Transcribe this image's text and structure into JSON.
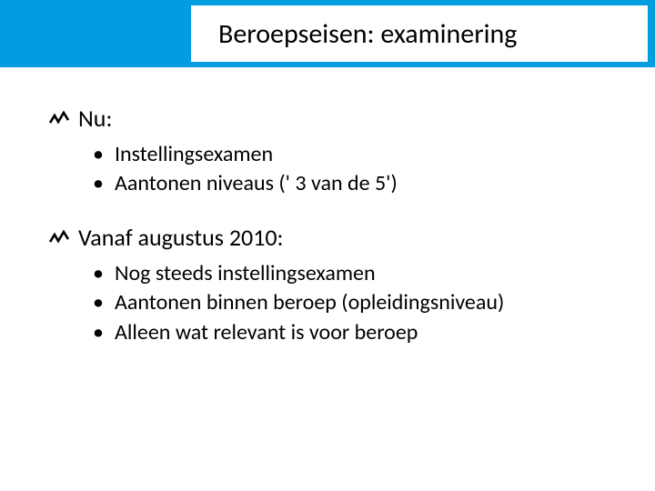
{
  "header": {
    "title": "Beroepseisen: examinering"
  },
  "sections": [
    {
      "heading": "Nu:",
      "items": [
        "Instellingsexamen",
        "Aantonen niveaus (' 3 van de 5')"
      ]
    },
    {
      "heading": "Vanaf augustus 2010:",
      "items": [
        "Nog steeds instellingsexamen",
        "Aantonen binnen beroep (opleidingsniveau)",
        "Alleen wat relevant is voor beroep"
      ]
    }
  ]
}
